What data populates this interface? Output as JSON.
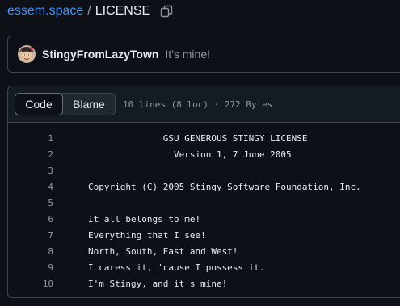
{
  "breadcrumb": {
    "repo": "essem.space",
    "separator": "/",
    "file": "LICENSE"
  },
  "icons": {
    "copy": "copy-icon"
  },
  "commit": {
    "author": "StingyFromLazyTown",
    "message": "It's mine!"
  },
  "file_header": {
    "tabs": [
      {
        "label": "Code",
        "selected": true
      },
      {
        "label": "Blame",
        "selected": false
      }
    ],
    "info": "10 lines (8 loc) · 272 Bytes"
  },
  "code": {
    "lines": [
      {
        "num": "1",
        "text": "              GSU GENEROUS STINGY LICENSE"
      },
      {
        "num": "2",
        "text": "                Version 1, 7 June 2005"
      },
      {
        "num": "3",
        "text": ""
      },
      {
        "num": "4",
        "text": "Copyright (C) 2005 Stingy Software Foundation, Inc."
      },
      {
        "num": "5",
        "text": ""
      },
      {
        "num": "6",
        "text": "It all belongs to me!"
      },
      {
        "num": "7",
        "text": "Everything that I see!"
      },
      {
        "num": "8",
        "text": "North, South, East and West!"
      },
      {
        "num": "9",
        "text": "I caress it, 'cause I possess it."
      },
      {
        "num": "10",
        "text": "I'm Stingy, and it's mine!"
      }
    ]
  },
  "colors": {
    "background": "#0d1117",
    "link": "#4493f8",
    "border": "#3d444d",
    "muted": "#9198a1",
    "text": "#e6edf3"
  }
}
